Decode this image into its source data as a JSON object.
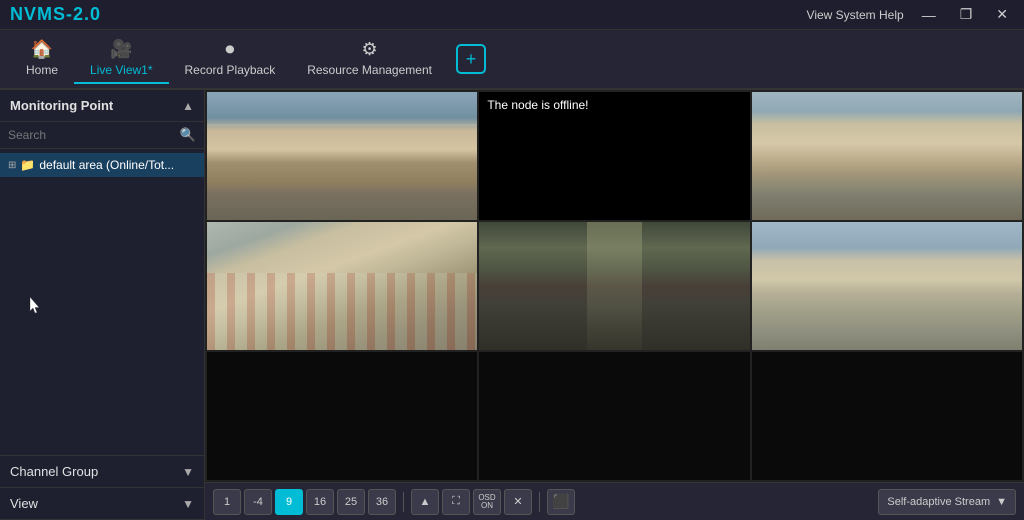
{
  "titlebar": {
    "app_name": "NVMS-2.0",
    "help_label": "View System Help",
    "minimize_label": "—",
    "restore_label": "❐",
    "close_label": "✕"
  },
  "navbar": {
    "home_label": "Home",
    "live_view_label": "Live View1*",
    "record_playback_label": "Record Playback",
    "resource_mgmt_label": "Resource Management",
    "add_tab_label": "+"
  },
  "sidebar": {
    "monitoring_point_label": "Monitoring Point",
    "search_placeholder": "Search",
    "tree_item_label": "default area (Online/Tot...",
    "channel_group_label": "Channel Group",
    "view_label": "View"
  },
  "camera_grid": {
    "offline_message": "The node is offline!"
  },
  "toolbar": {
    "btn_1": "1",
    "btn_4": "-4",
    "btn_9": "9",
    "btn_16": "16",
    "btn_25": "25",
    "btn_36": "36",
    "stream_label": "Self-adaptive Stream"
  }
}
